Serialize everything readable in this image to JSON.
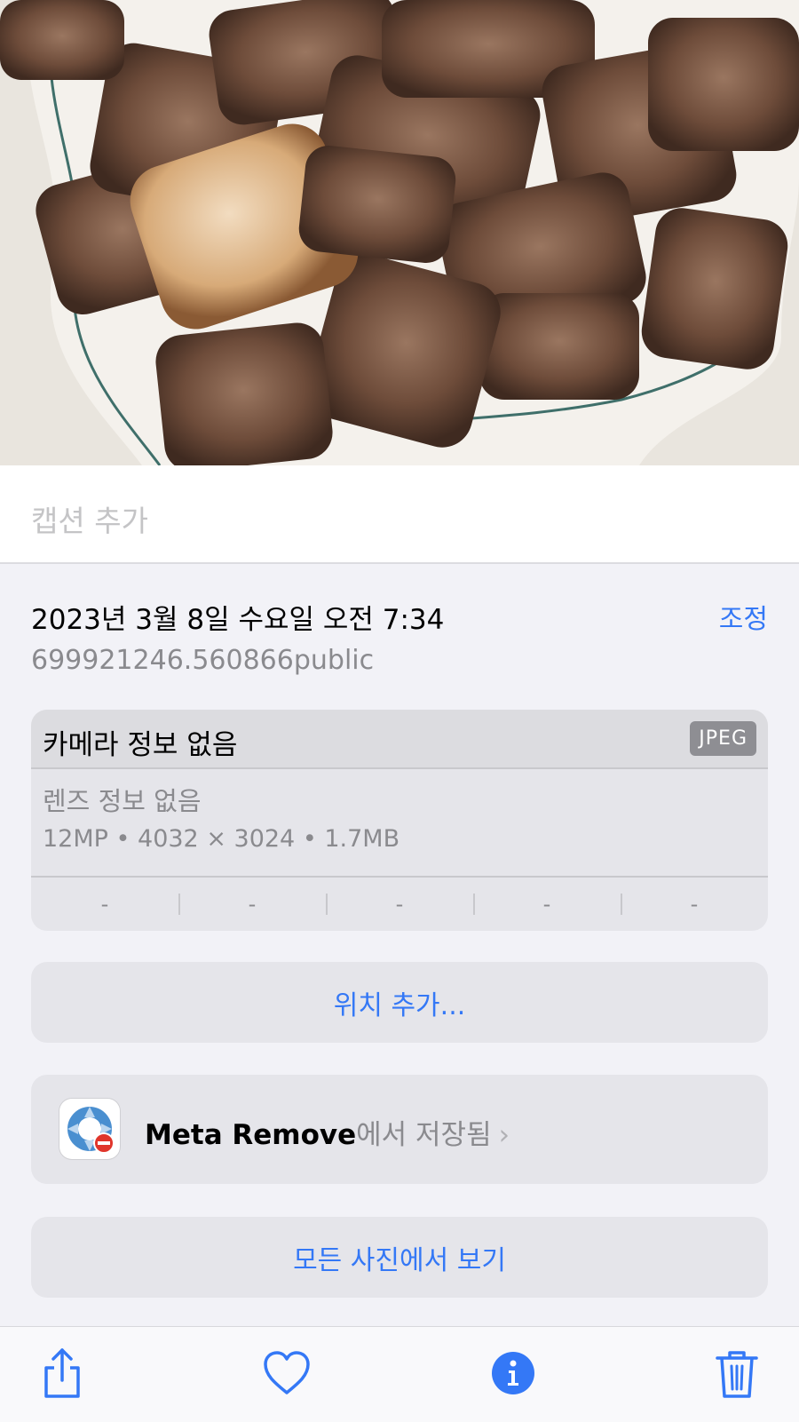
{
  "caption": {
    "placeholder": "캡션 추가"
  },
  "info": {
    "datetime": "2023년 3월 8일 수요일 오전 7:34",
    "adjust_label": "조정",
    "filename": "699921246.560866public"
  },
  "camera": {
    "title": "카메라 정보 없음",
    "format_badge": "JPEG",
    "lens": "렌즈 정보 없음",
    "specs": "12MP  •  4032 × 3024  •  1.7MB",
    "exif_values": [
      "-",
      "-",
      "-",
      "-",
      "-"
    ]
  },
  "location": {
    "add_label": "위치 추가..."
  },
  "source_app": {
    "app_name": "Meta Remove",
    "saved_suffix": "에서 저장됨",
    "chevron": "›"
  },
  "all_photos": {
    "label": "모든 사진에서 보기"
  },
  "toolbar": {
    "icons": [
      "share-icon",
      "heart-icon",
      "info-icon",
      "trash-icon"
    ],
    "accent": "#3478f6"
  },
  "colors": {
    "accent": "#3478f6",
    "secondary_text": "#8a8a8e",
    "card_bg": "#e5e5ea"
  }
}
